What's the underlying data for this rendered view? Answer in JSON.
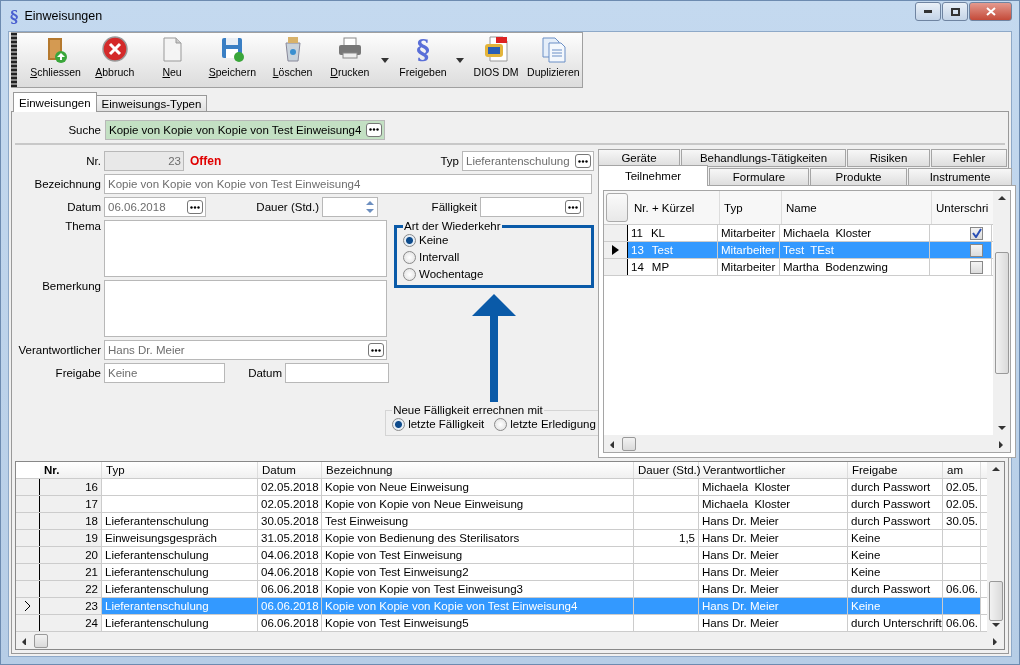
{
  "window": {
    "icon": "§",
    "title": "Einweisungen"
  },
  "toolbar": [
    {
      "label": "Schliessen",
      "mnemonic": true,
      "dropdown": false
    },
    {
      "label": "Abbruch",
      "mnemonic": true,
      "dropdown": false
    },
    {
      "label": "Neu",
      "mnemonic": true,
      "dropdown": false
    },
    {
      "label": "Speichern",
      "mnemonic": true,
      "dropdown": false
    },
    {
      "label": "Löschen",
      "mnemonic": true,
      "dropdown": false
    },
    {
      "label": "Drucken",
      "mnemonic": true,
      "dropdown": true
    },
    {
      "label": "Freigeben",
      "glyph": "§",
      "mnemonic": false,
      "dropdown": true
    },
    {
      "label": "DIOS DM",
      "mnemonic": false,
      "dropdown": false
    },
    {
      "label": "Duplizieren",
      "mnemonic": false,
      "dropdown": false
    }
  ],
  "tabs": [
    {
      "label": "Einweisungen",
      "selected": true
    },
    {
      "label": "Einweisungs-Typen",
      "selected": false
    }
  ],
  "search": {
    "label": "Suche",
    "value": "Kopie von Kopie von Kopie von Test Einweisung4"
  },
  "form": {
    "nr_label": "Nr.",
    "nr": "23",
    "status": "Offen",
    "typ_label": "Typ",
    "typ": "Lieferantenschulung",
    "bezeichnung_label": "Bezeichnung",
    "bezeichnung": "Kopie von Kopie von Kopie von Test Einweisung4",
    "datum_label": "Datum",
    "datum": "06.06.2018",
    "dauer_label": "Dauer (Std.)",
    "faelligkeit_label": "Fälligkeit",
    "thema_label": "Thema",
    "bemerkung_label": "Bemerkung",
    "verantwortlicher_label": "Verantwortlicher",
    "verantwortlicher": "Hans Dr. Meier",
    "freigabe_label": "Freigabe",
    "freigabe": "Keine",
    "freigabe_datum_label": "Datum"
  },
  "recurrence": {
    "title": "Art der Wiederkehr",
    "highlighted": true,
    "options": [
      {
        "label": "Keine",
        "selected": true
      },
      {
        "label": "Intervall",
        "selected": false
      },
      {
        "label": "Wochentage",
        "selected": false
      }
    ]
  },
  "due_basis": {
    "title": "Neue Fälligkeit errechnen mit",
    "options": [
      {
        "label": "letzte Fälligkeit",
        "selected": true
      },
      {
        "label": "letzte Erledigung",
        "selected": false
      }
    ]
  },
  "detail_tabs": [
    [
      {
        "label": "Geräte",
        "selected": false
      },
      {
        "label": "Behandlungs-Tätigkeiten",
        "selected": false
      },
      {
        "label": "Risiken",
        "selected": false
      },
      {
        "label": "Fehler",
        "selected": false
      }
    ],
    [
      {
        "label": "Teilnehmer",
        "selected": true
      },
      {
        "label": "Formulare",
        "selected": false
      },
      {
        "label": "Produkte",
        "selected": false
      },
      {
        "label": "Instrumente",
        "selected": false
      }
    ]
  ],
  "participants": {
    "columns": [
      "Nr. + Kürzel",
      "Typ",
      "Name",
      "Unterschri"
    ],
    "rows": [
      {
        "nr": "11",
        "code": "KL",
        "typ": "Mitarbeiter",
        "name": "Michaela  Kloster",
        "signed": true,
        "selected": false
      },
      {
        "nr": "13",
        "code": "Test",
        "typ": "Mitarbeiter",
        "name": "Test  TEst",
        "signed": false,
        "selected": true
      },
      {
        "nr": "14",
        "code": "MP",
        "typ": "Mitarbeiter",
        "name": "Martha  Bodenzwing",
        "signed": false,
        "selected": false
      }
    ]
  },
  "table": {
    "columns": [
      "Nr.",
      "Typ",
      "Datum",
      "Bezeichnung",
      "Dauer (Std.)",
      "Verantwortlicher",
      "Freigabe",
      "am"
    ],
    "rows": [
      {
        "cells": [
          "16",
          "",
          "02.05.2018",
          "Kopie von Neue Einweisung",
          "",
          "Michaela  Kloster",
          "durch Passwort",
          "02.05."
        ],
        "selected": false
      },
      {
        "cells": [
          "17",
          "",
          "02.05.2018",
          "Kopie von Kopie von Neue Einweisung",
          "",
          "Michaela  Kloster",
          "durch Passwort",
          "02.05."
        ],
        "selected": false
      },
      {
        "cells": [
          "18",
          "Lieferantenschulung",
          "30.05.2018",
          "Test Einweisung",
          "",
          "Hans Dr. Meier",
          "durch Passwort",
          "30.05."
        ],
        "selected": false
      },
      {
        "cells": [
          "19",
          "Einweisungsgespräch",
          "31.05.2018",
          "Kopie von Bedienung des Sterilisators",
          "1,5",
          "Hans Dr. Meier",
          "Keine",
          ""
        ],
        "selected": false
      },
      {
        "cells": [
          "20",
          "Lieferantenschulung",
          "04.06.2018",
          "Kopie von Test Einweisung",
          "",
          "Hans Dr. Meier",
          "Keine",
          ""
        ],
        "selected": false
      },
      {
        "cells": [
          "21",
          "Lieferantenschulung",
          "04.06.2018",
          "Kopie von Test Einweisung2",
          "",
          "Hans Dr. Meier",
          "Keine",
          ""
        ],
        "selected": false
      },
      {
        "cells": [
          "22",
          "Lieferantenschulung",
          "06.06.2018",
          "Kopie von Kopie von Test Einweisung3",
          "",
          "Hans Dr. Meier",
          "durch Passwort",
          "06.06."
        ],
        "selected": false
      },
      {
        "cells": [
          "23",
          "Lieferantenschulung",
          "06.06.2018",
          "Kopie von Kopie von Kopie von Test Einweisung4",
          "",
          "Hans Dr. Meier",
          "Keine",
          ""
        ],
        "selected": true
      },
      {
        "cells": [
          "24",
          "Lieferantenschulung",
          "06.06.2018",
          "Kopie von Test Einweisung5",
          "",
          "Hans Dr. Meier",
          "durch Unterschrift",
          "06.06."
        ],
        "selected": false
      }
    ]
  }
}
